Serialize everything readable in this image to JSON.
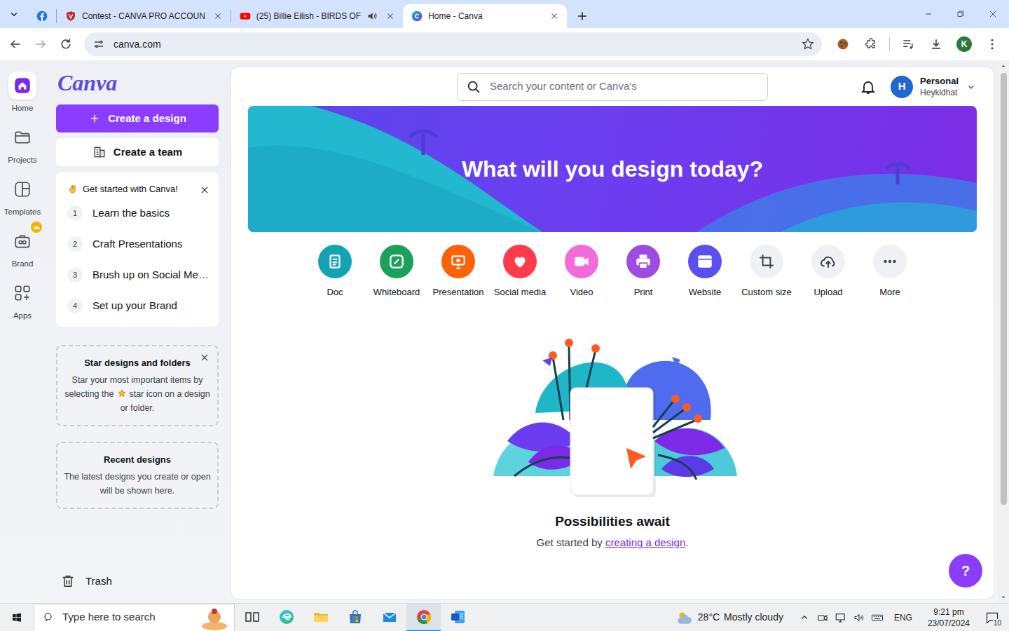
{
  "browser": {
    "pinned_tab": {
      "selected": false
    },
    "tabs": [
      {
        "label": "Contest - CANVA PRO ACCOUN",
        "selected": false,
        "audio": false
      },
      {
        "label": "(25) Billie Eilish - BIRDS OF",
        "selected": false,
        "audio": true
      },
      {
        "label": "Home - Canva",
        "selected": true,
        "audio": false
      }
    ],
    "can_go_forward": false,
    "address": "canva.com",
    "bookmarked": false,
    "profile_initial": "K"
  },
  "canva": {
    "logo": "Canva",
    "rail": [
      {
        "label": "Home",
        "selected": true,
        "premium": false
      },
      {
        "label": "Projects",
        "selected": false,
        "premium": false
      },
      {
        "label": "Templates",
        "selected": false,
        "premium": false
      },
      {
        "label": "Brand",
        "selected": false,
        "premium": true
      },
      {
        "label": "Apps",
        "selected": false,
        "premium": false
      }
    ],
    "create_design": "Create a design",
    "create_team": "Create a team",
    "get_started": {
      "title": "Get started with Canva!",
      "steps": [
        {
          "number": "1",
          "label": "Learn the basics"
        },
        {
          "number": "2",
          "label": "Craft Presentations"
        },
        {
          "number": "3",
          "label": "Brush up on Social Me…"
        },
        {
          "number": "4",
          "label": "Set up your Brand"
        }
      ]
    },
    "star_card": {
      "title": "Star designs and folders",
      "text_before": "Star your most important items by selecting the",
      "text_after": "star icon on a design or folder."
    },
    "recent_card": {
      "title": "Recent designs",
      "text": "The latest designs you create or open will be shown here."
    },
    "trash": "Trash",
    "search": {
      "placeholder": "Search your content or Canva's"
    },
    "account": {
      "initial": "H",
      "plan": "Personal",
      "name": "Heykidhat"
    },
    "banner": {
      "title": "What will you design today?"
    },
    "categories": [
      {
        "label": "Doc",
        "color": "#13a3b5"
      },
      {
        "label": "Whiteboard",
        "color": "#1aa15a"
      },
      {
        "label": "Presentation",
        "color": "#ff6105"
      },
      {
        "label": "Social media",
        "color": "#ff3b4b"
      },
      {
        "label": "Video",
        "color": "#f26bd8"
      },
      {
        "label": "Print",
        "color": "#9c4ce0"
      },
      {
        "label": "Website",
        "color": "#5b4ff0"
      },
      {
        "label": "Custom size",
        "color": "#f0f1f4"
      },
      {
        "label": "Upload",
        "color": "#f0f1f4"
      },
      {
        "label": "More",
        "color": "#f0f1f4"
      }
    ],
    "empty_state": {
      "title": "Possibilities await",
      "text_before": "Get started by ",
      "link": "creating a design",
      "text_after": "."
    },
    "help": "?"
  },
  "taskbar": {
    "search_placeholder": "Type here to search",
    "apps": [
      {
        "selected": false
      },
      {
        "selected": false
      },
      {
        "selected": false
      },
      {
        "selected": false
      },
      {
        "selected": false
      },
      {
        "selected": true
      },
      {
        "selected": false
      }
    ],
    "weather": {
      "temperature": "28°C",
      "condition": "Mostly cloudy"
    },
    "language": "ENG",
    "time": "9:21 pm",
    "date": "23/07/2024",
    "notifications": "10"
  }
}
